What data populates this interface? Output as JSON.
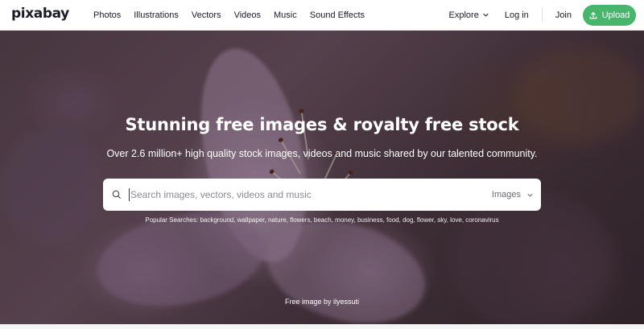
{
  "nav": {
    "logo": "pixabay",
    "links": [
      "Photos",
      "Illustrations",
      "Vectors",
      "Videos",
      "Music",
      "Sound Effects"
    ],
    "explore_label": "Explore",
    "login_label": "Log in",
    "join_label": "Join",
    "upload_label": "Upload"
  },
  "hero": {
    "title": "Stunning free images & royalty free stock",
    "subtitle": "Over 2.6 million+ high quality stock images, videos and music shared by our talented community.",
    "search": {
      "placeholder": "Search images, vectors, videos and music",
      "value": "",
      "type_selected": "Images"
    },
    "popular_label": "Popular Searches:",
    "popular_terms": [
      "background",
      "wallpaper",
      "nature",
      "flowers",
      "beach",
      "money",
      "business",
      "food",
      "dog",
      "flower",
      "sky",
      "love",
      "coronavirus"
    ],
    "credit": "Free image by ilyessuti"
  },
  "icons": {
    "explore": "chevron-down-icon",
    "upload": "upload-icon",
    "search": "search-icon",
    "type": "chevron-down-icon"
  },
  "colors": {
    "accent": "#48b56d",
    "nav_bg": "#ffffff",
    "text": "#191b26"
  }
}
